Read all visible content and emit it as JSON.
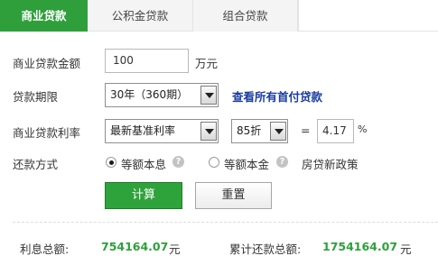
{
  "tabs": [
    {
      "label": "商业贷款"
    },
    {
      "label": "公积金贷款"
    },
    {
      "label": "组合贷款"
    }
  ],
  "form": {
    "amount_label": "商业贷款金额",
    "amount_value": "100",
    "amount_unit": "万元",
    "term_label": "贷款期限",
    "term_value": "30年（360期）",
    "term_link": "查看所有首付贷款",
    "rate_label": "商业贷款利率",
    "rate_type_value": "最新基准利率",
    "rate_discount_value": "85折",
    "equals": "=",
    "rate_result": "4.17",
    "percent": "%",
    "repay_label": "还款方式",
    "repay_options": [
      {
        "label": "等额本息",
        "selected": true
      },
      {
        "label": "等额本金",
        "selected": false
      }
    ],
    "policy_link": "房贷新政策"
  },
  "buttons": {
    "calc": "计算",
    "reset": "重置"
  },
  "results": {
    "interest_label": "利息总额:",
    "interest_value": "754164.07",
    "interest_unit": "元",
    "total_label": "累计还款总额:",
    "total_value": "1754164.07",
    "total_unit": "元"
  },
  "colors": {
    "accent": "#2f9f3b",
    "link": "#1a3c9e"
  },
  "icons": {
    "help": "?"
  }
}
